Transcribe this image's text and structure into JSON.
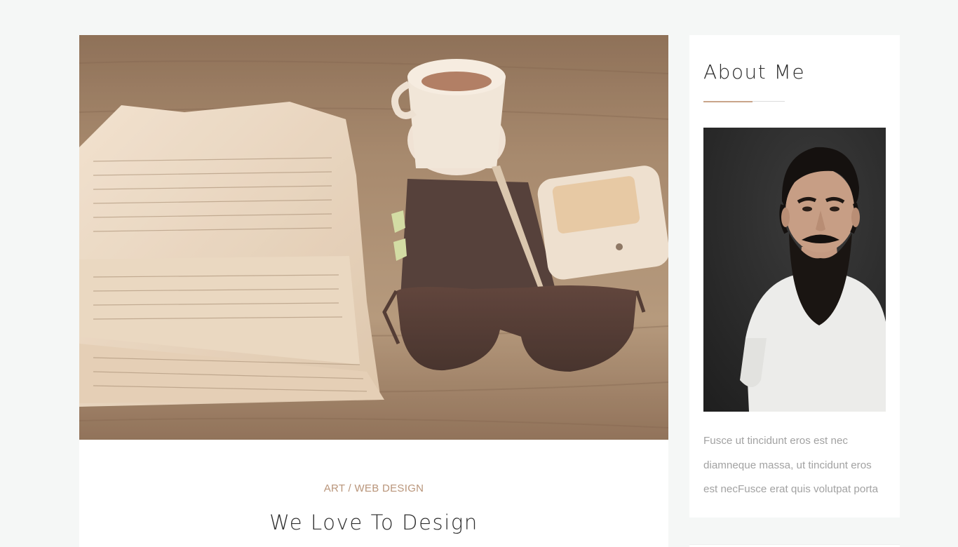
{
  "post": {
    "image_alt": "Newspaper, coffee cup, notebook with pen, phone and sunglasses on a wooden table",
    "categories": [
      "Art",
      "Web Design"
    ],
    "category_separator": "/",
    "title": "We Love To Design"
  },
  "sidebar": {
    "about": {
      "title": "About Me",
      "photo_alt": "Portrait of a bearded man in a white t-shirt",
      "text": "Fusce ut tincidunt eros est nec diamneque massa, ut tincidunt eros est necFusce erat quis volutpat porta"
    }
  },
  "colors": {
    "page_background": "#f5f7f6",
    "card_background": "#ffffff",
    "accent": "#c9a58a",
    "category_text": "#b9957a",
    "title_text": "#2e2e2e",
    "body_text": "#a2a2a2"
  }
}
